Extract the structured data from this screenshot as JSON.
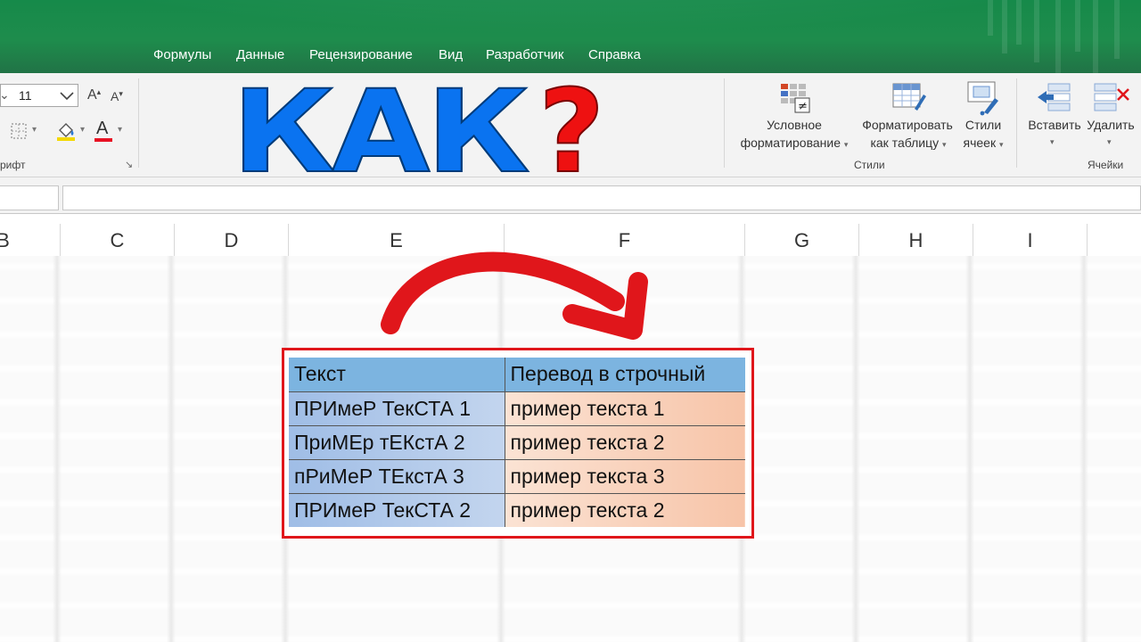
{
  "ribbon_tabs": [
    "Формулы",
    "Данные",
    "Рецензирование",
    "Вид",
    "Разработчик",
    "Справка"
  ],
  "font_group": {
    "font_size": "11",
    "increase_font_glyph": "A",
    "decrease_font_glyph": "A",
    "font_color_glyph": "A",
    "label": "рифт",
    "dialog_launcher": "↘"
  },
  "styles_group": {
    "conditional_formatting_line1": "Условное",
    "conditional_formatting_line2": "форматирование",
    "format_as_table_line1": "Форматировать",
    "format_as_table_line2": "как таблицу",
    "cell_styles_line1": "Стили",
    "cell_styles_line2": "ячеек",
    "label": "Стили"
  },
  "cells_group": {
    "insert_label": "Вставить",
    "delete_label": "Удалить",
    "label": "Ячейки"
  },
  "overlay": {
    "big_text": "КАК",
    "question_mark": "?"
  },
  "columns": [
    "B",
    "C",
    "D",
    "E",
    "F",
    "G",
    "H",
    "I"
  ],
  "table": {
    "headers": [
      "Текст",
      "Перевод в строчный"
    ],
    "rows": [
      [
        "ПРИмеР ТекСТА 1",
        "пример текста 1"
      ],
      [
        "ПриМЕр тЕКстА 2",
        "пример текста 2"
      ],
      [
        "пРиМеР ТЕкстА 3",
        "пример текста 3"
      ],
      [
        "ПРИмеР ТекСТА 2",
        "пример текста 2"
      ]
    ]
  },
  "colors": {
    "ribbon_green": "#217346",
    "frame_red": "#e0161b",
    "kak_blue": "#0a73f0",
    "question_red": "#ee1111",
    "header_blue": "#7cb4e0"
  }
}
